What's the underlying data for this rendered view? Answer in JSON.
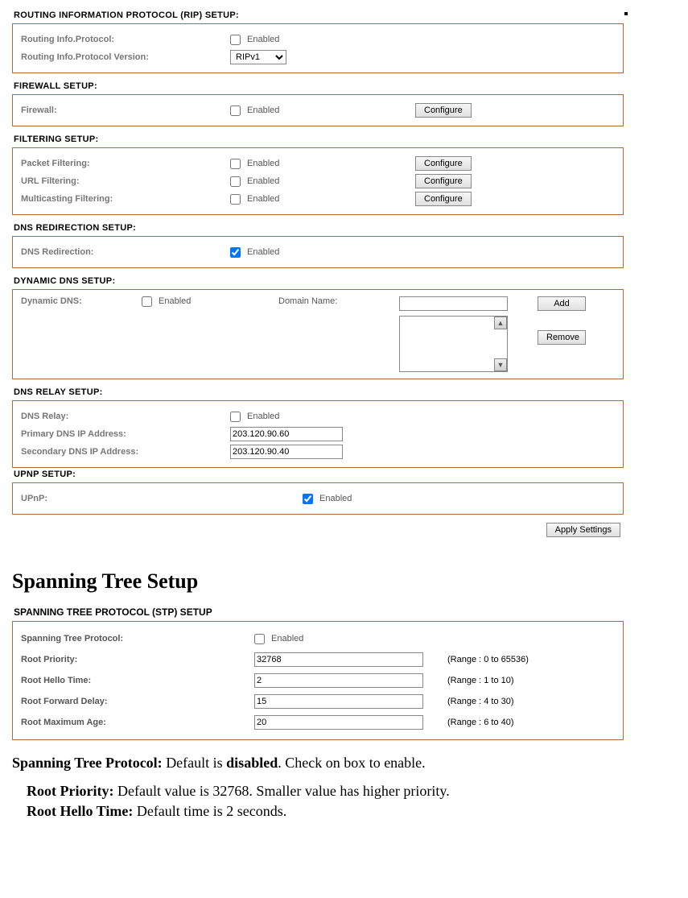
{
  "rip": {
    "title": "ROUTING INFORMATION PROTOCOL (RIP) SETUP:",
    "proto_label": "Routing Info.Protocol:",
    "enabled_label": "Enabled",
    "version_label": "Routing Info.Protocol Version:",
    "version_value": "RIPv1"
  },
  "firewall": {
    "title": "FIREWALL SETUP:",
    "label": "Firewall:",
    "enabled_label": "Enabled",
    "configure": "Configure"
  },
  "filtering": {
    "title": "FILTERING SETUP:",
    "packet_label": "Packet Filtering:",
    "url_label": "URL Filtering:",
    "multicast_label": "Multicasting Filtering:",
    "enabled_label": "Enabled",
    "configure": "Configure"
  },
  "dnsredir": {
    "title": "DNS REDIRECTION SETUP:",
    "label": "DNS Redirection:",
    "enabled_label": "Enabled"
  },
  "ddns": {
    "title": "DYNAMIC DNS SETUP:",
    "label": "Dynamic DNS:",
    "enabled_label": "Enabled",
    "domain_label": "Domain Name:",
    "add": "Add",
    "remove": "Remove"
  },
  "dnsrelay": {
    "title": "DNS RELAY SETUP:",
    "relay_label": "DNS Relay:",
    "enabled_label": "Enabled",
    "primary_label": "Primary DNS IP Address:",
    "primary_value": "203.120.90.60",
    "secondary_label": "Secondary DNS IP Address:",
    "secondary_value": "203.120.90.40"
  },
  "upnp": {
    "title": "UPNP SETUP:",
    "label": "UPnP:",
    "enabled_label": "Enabled"
  },
  "apply": "Apply Settings",
  "doc_heading": "Spanning Tree Setup",
  "stp": {
    "title": "SPANNING TREE PROTOCOL (STP) SETUP",
    "proto_label": "Spanning Tree Protocol:",
    "enabled_label": "Enabled",
    "priority_label": "Root Priority:",
    "priority_value": "32768",
    "priority_range": "(Range : 0 to 65536)",
    "hello_label": "Root Hello Time:",
    "hello_value": "2",
    "hello_range": "(Range : 1 to 10)",
    "fwd_label": "Root Forward Delay:",
    "fwd_value": "15",
    "fwd_range": "(Range : 4 to 30)",
    "max_label": "Root Maximum Age:",
    "max_value": "20",
    "max_range": "(Range : 6 to 40)"
  },
  "doctext": {
    "line1_a": "Spanning Tree Protocol: ",
    "line1_b": "Default is ",
    "line1_c": "disabled",
    "line1_d": ". Check on box to enable.",
    "line2_a": "Root Priority: ",
    "line2_b": "Default value is 32768. Smaller value has higher priority.",
    "line3_a": "Root Hello Time: ",
    "line3_b": "Default time is 2 seconds."
  }
}
